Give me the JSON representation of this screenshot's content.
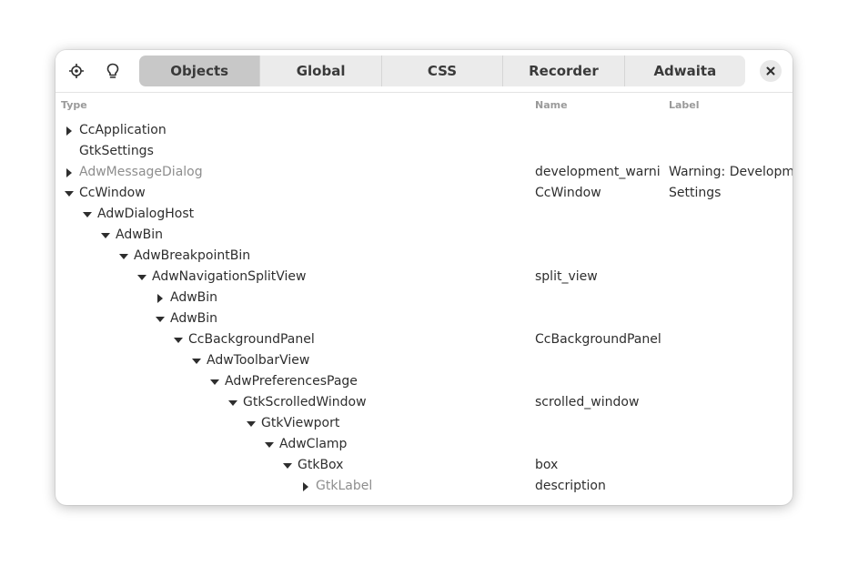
{
  "header": {
    "picker_icon": "crosshair-icon",
    "hint_icon": "lightbulb-icon",
    "tabs": [
      {
        "label": "Objects",
        "active": true
      },
      {
        "label": "Global",
        "active": false
      },
      {
        "label": "CSS",
        "active": false
      },
      {
        "label": "Recorder",
        "active": false
      },
      {
        "label": "Adwaita",
        "active": false
      }
    ],
    "close_icon": "close-icon"
  },
  "columns": {
    "type": "Type",
    "name": "Name",
    "label": "Label"
  },
  "rows": [
    {
      "type": "CcApplication",
      "depth": 0,
      "expander": "collapsed",
      "dim": false,
      "name": "",
      "label": ""
    },
    {
      "type": "GtkSettings",
      "depth": 0,
      "expander": "none",
      "dim": false,
      "name": "",
      "label": ""
    },
    {
      "type": "AdwMessageDialog",
      "depth": 0,
      "expander": "collapsed",
      "dim": true,
      "name": "development_warnir",
      "label": "Warning: Developm"
    },
    {
      "type": "CcWindow",
      "depth": 0,
      "expander": "expanded",
      "dim": false,
      "name": "CcWindow",
      "label": "Settings"
    },
    {
      "type": "AdwDialogHost",
      "depth": 1,
      "expander": "expanded",
      "dim": false,
      "name": "",
      "label": ""
    },
    {
      "type": "AdwBin",
      "depth": 2,
      "expander": "expanded",
      "dim": false,
      "name": "",
      "label": ""
    },
    {
      "type": "AdwBreakpointBin",
      "depth": 3,
      "expander": "expanded",
      "dim": false,
      "name": "",
      "label": ""
    },
    {
      "type": "AdwNavigationSplitView",
      "depth": 4,
      "expander": "expanded",
      "dim": false,
      "name": "split_view",
      "label": ""
    },
    {
      "type": "AdwBin",
      "depth": 5,
      "expander": "collapsed",
      "dim": false,
      "name": "",
      "label": ""
    },
    {
      "type": "AdwBin",
      "depth": 5,
      "expander": "expanded",
      "dim": false,
      "name": "",
      "label": ""
    },
    {
      "type": "CcBackgroundPanel",
      "depth": 6,
      "expander": "expanded",
      "dim": false,
      "name": "CcBackgroundPanel",
      "label": ""
    },
    {
      "type": "AdwToolbarView",
      "depth": 7,
      "expander": "expanded",
      "dim": false,
      "name": "",
      "label": ""
    },
    {
      "type": "AdwPreferencesPage",
      "depth": 8,
      "expander": "expanded",
      "dim": false,
      "name": "",
      "label": ""
    },
    {
      "type": "GtkScrolledWindow",
      "depth": 9,
      "expander": "expanded",
      "dim": false,
      "name": "scrolled_window",
      "label": ""
    },
    {
      "type": "GtkViewport",
      "depth": 10,
      "expander": "expanded",
      "dim": false,
      "name": "",
      "label": ""
    },
    {
      "type": "AdwClamp",
      "depth": 11,
      "expander": "expanded",
      "dim": false,
      "name": "",
      "label": ""
    },
    {
      "type": "GtkBox",
      "depth": 12,
      "expander": "expanded",
      "dim": false,
      "name": "box",
      "label": ""
    },
    {
      "type": "GtkLabel",
      "depth": 13,
      "expander": "collapsed",
      "dim": true,
      "name": "description",
      "label": ""
    }
  ]
}
